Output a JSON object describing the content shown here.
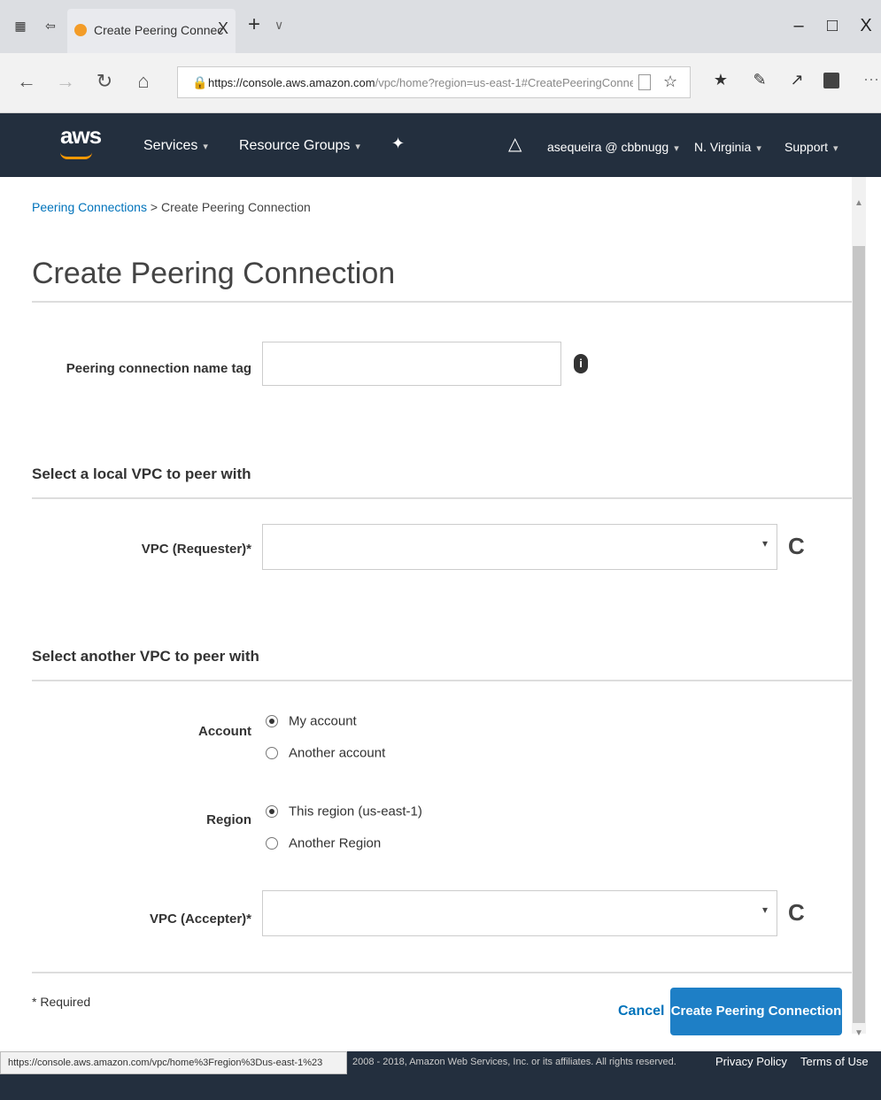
{
  "browser": {
    "tab_title": "Create Peering Connec",
    "tab_close": "X",
    "new_tab": "+",
    "tab_menu": "∨",
    "window_buttons": [
      "–",
      "□",
      "X"
    ],
    "url_domain": "https://console.aws.amazon.com",
    "url_path": "/vpc/home?region=us-east-1#CreatePeeringConne",
    "nav_icons": [
      "back-icon",
      "forward-icon",
      "refresh-icon",
      "home-icon"
    ]
  },
  "aws_nav": {
    "logo": "aws",
    "services": "Services",
    "resource_groups": "Resource Groups",
    "account": "asequeira @ cbbnugg",
    "region": "N. Virginia",
    "support": "Support",
    "caret": "▾"
  },
  "breadcrumb": {
    "link": "Peering Connections",
    "separator": " > ",
    "current": "Create Peering Connection"
  },
  "page_title": "Create Peering Connection",
  "form": {
    "name_tag_label": "Peering connection name tag",
    "name_tag_value": "",
    "info_icon": "i",
    "local_section": "Select a local VPC to peer with",
    "requester_label": "VPC (Requester)*",
    "requester_value": "",
    "another_section": "Select another VPC to peer with",
    "account_label": "Account",
    "account_options": [
      "My account",
      "Another account"
    ],
    "account_selected": "My account",
    "region_label": "Region",
    "region_options": [
      "This region (us-east-1)",
      "Another Region"
    ],
    "region_selected": "This region (us-east-1)",
    "accepter_label": "VPC (Accepter)*",
    "accepter_value": "",
    "refresh_glyph": "C",
    "dropdown_arrow": "▾",
    "required_note": "* Required",
    "cancel": "Cancel",
    "submit": "Create Peering Connection"
  },
  "footer": {
    "status_url": "https://console.aws.amazon.com/vpc/home%3Fregion%3Dus-east-1%23",
    "copyright": "2008 - 2018, Amazon Web Services, Inc. or its affiliates. All rights reserved.",
    "privacy": "Privacy Policy",
    "terms": "Terms of Use"
  },
  "colors": {
    "aws_nav_bg": "#232f3e",
    "link": "#0073bb",
    "primary_button": "#1e7fc6",
    "aws_orange": "#ff9900"
  }
}
